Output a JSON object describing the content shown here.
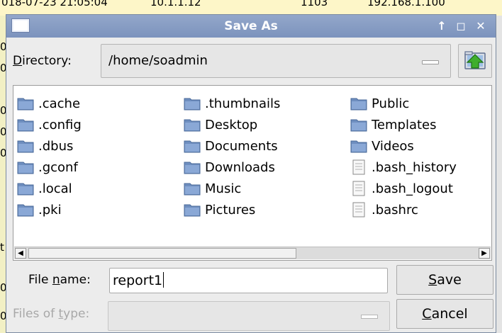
{
  "background": {
    "row_fragments": [
      "018-07-23 21:05:04",
      "10.1.1.12",
      "1103",
      "192.168.1.100"
    ],
    "left_chars": [
      "0",
      "0",
      "0",
      "0",
      "0",
      "t",
      "0",
      "0"
    ]
  },
  "dialog": {
    "title": "Save As",
    "title_buttons": [
      "↑",
      "◻",
      "✕"
    ],
    "directory_label_underlined": "D",
    "directory_label_rest": "irectory:",
    "directory_value": "/home/soadmin",
    "up_button_icon": "up-folder-icon",
    "files": {
      "col1": [
        ".cache",
        ".config",
        ".dbus",
        ".gconf",
        ".local",
        ".pki"
      ],
      "col2": [
        ".thumbnails",
        "Desktop",
        "Documents",
        "Downloads",
        "Music",
        "Pictures"
      ],
      "col3_folders": [
        "Public",
        "Templates",
        "Videos"
      ],
      "col3_files": [
        ".bash_history",
        ".bash_logout",
        ".bashrc"
      ]
    },
    "file_name_label_pre": "File ",
    "file_name_label_underlined": "n",
    "file_name_label_post": "ame:",
    "file_name_value": "report1",
    "save_underlined": "S",
    "save_rest": "ave",
    "files_of_type_label_pre": "Files of ",
    "files_of_type_label_underlined": "t",
    "files_of_type_label_post": "ype:",
    "cancel_underlined": "C",
    "cancel_rest": "ancel",
    "scroll_left_icon": "◀",
    "scroll_right_icon": "▶"
  },
  "colors": {
    "titlebar": "#7c93bd",
    "folder": "#6e8ebf",
    "dialog_bg": "#ececec"
  }
}
